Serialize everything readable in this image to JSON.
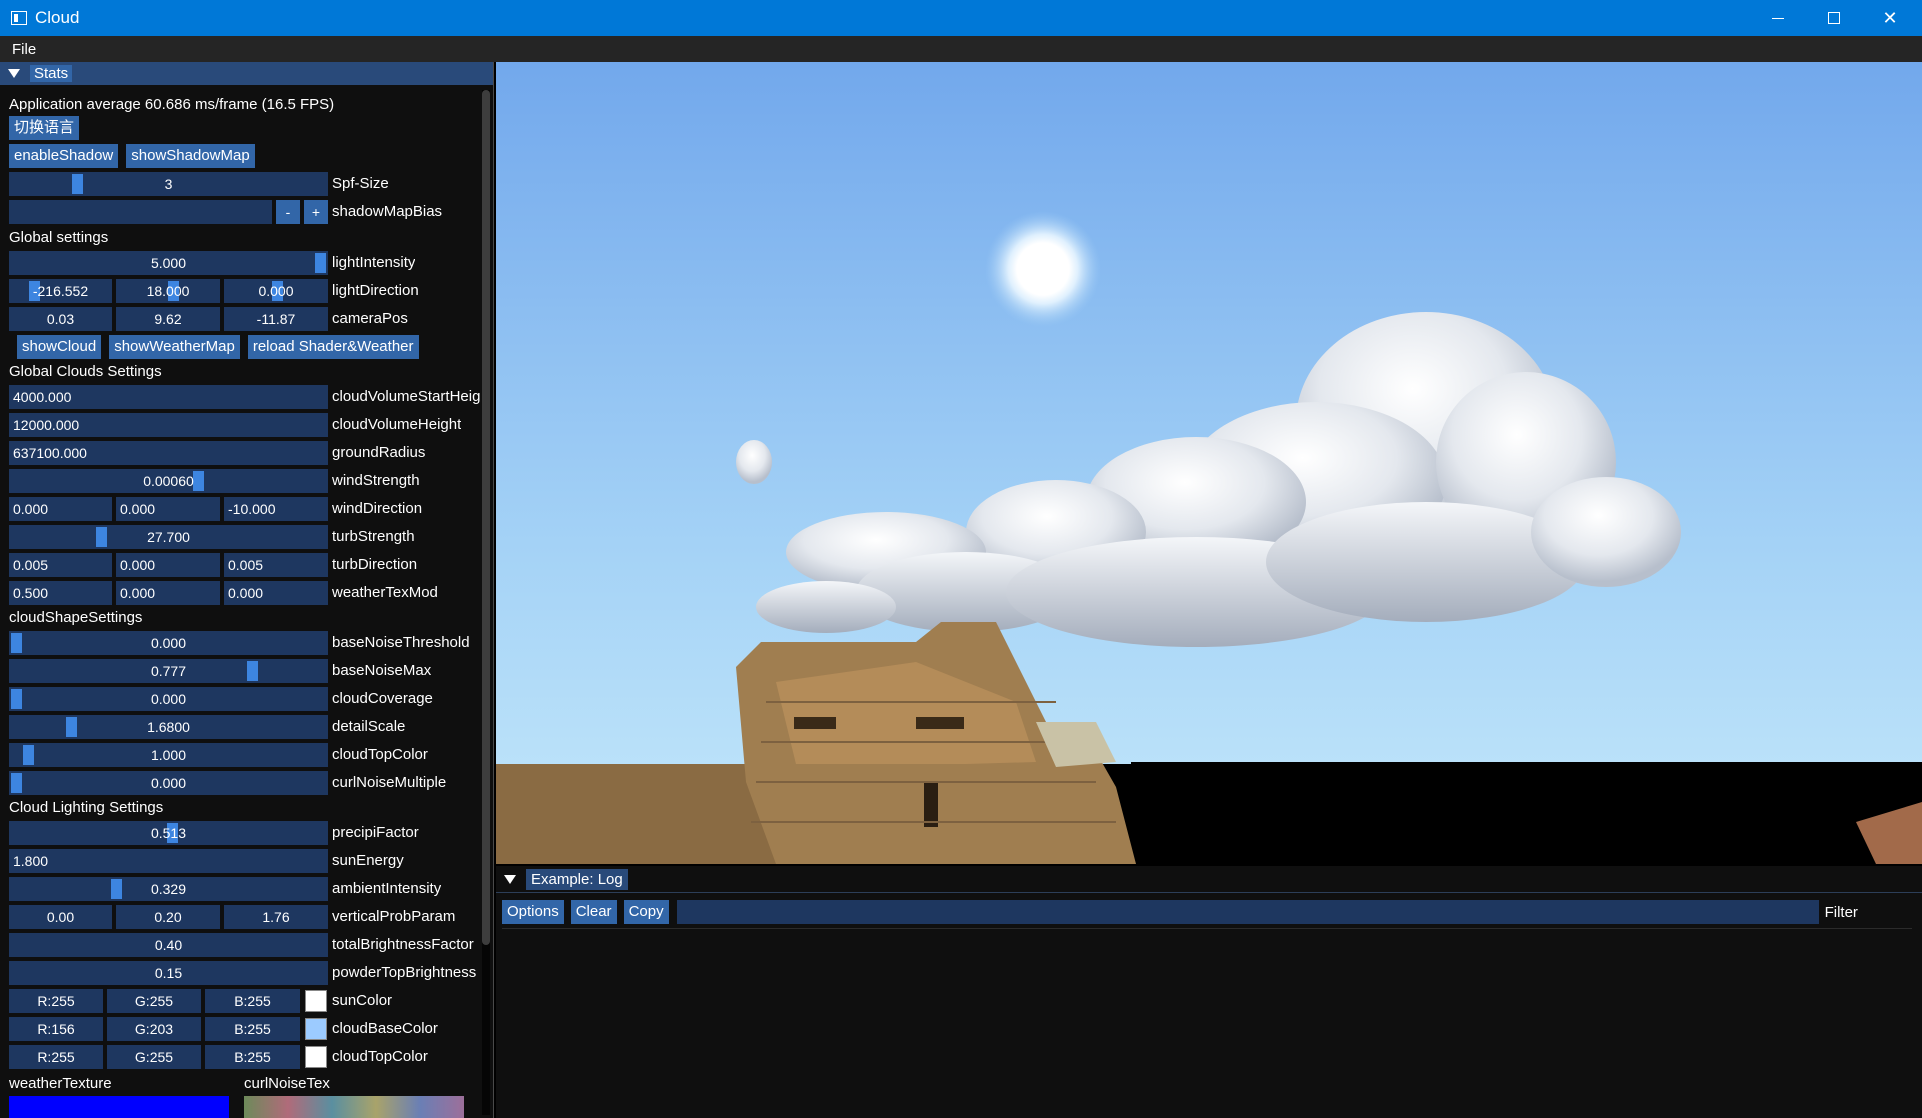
{
  "window": {
    "title": "Cloud",
    "min_icon": "minimize-icon",
    "max_icon": "maximize-icon",
    "close_icon": "close-icon"
  },
  "menu": {
    "file": "File"
  },
  "stats": {
    "header": "Stats",
    "fps_text": "Application average 60.686 ms/frame (16.5 FPS)",
    "language_button": "切换语言",
    "enable_shadow": "enableShadow",
    "show_shadow_map": "showShadowMap",
    "spf_size": {
      "value": "3",
      "label": "Spf-Size",
      "fraction": 0.2
    },
    "shadow_map_bias": {
      "value": "",
      "minus": "-",
      "plus": "+",
      "label": "shadowMapBias"
    },
    "global_settings": "Global settings",
    "light_intensity": {
      "value": "5.000",
      "label": "lightIntensity",
      "fraction": 1.0
    },
    "light_direction": {
      "values": [
        "-216.552",
        "18.000",
        "0.000"
      ],
      "label": "lightDirection"
    },
    "camera_pos": {
      "values": [
        "0.03",
        "9.62",
        "-11.87"
      ],
      "label": "cameraPos"
    },
    "show_cloud": "showCloud",
    "show_weather_map": "showWeatherMap",
    "reload_shader": "reload Shader&Weather",
    "global_clouds": "Global Clouds Settings",
    "cloud_volume_start": {
      "value": "4000.000",
      "label": "cloudVolumeStartHeig"
    },
    "cloud_volume_height": {
      "value": "12000.000",
      "label": "cloudVolumeHeight"
    },
    "ground_radius": {
      "value": "637100.000",
      "label": "groundRadius"
    },
    "wind_strength": {
      "value": "0.00060",
      "label": "windStrength",
      "fraction": 0.6
    },
    "wind_direction": {
      "values": [
        "0.000",
        "0.000",
        "-10.000"
      ],
      "label": "windDirection"
    },
    "turb_strength": {
      "value": "27.700",
      "label": "turbStrength",
      "fraction": 0.28
    },
    "turb_direction": {
      "values": [
        "0.005",
        "0.000",
        "0.005"
      ],
      "label": "turbDirection"
    },
    "weather_tex_mod": {
      "values": [
        "0.500",
        "0.000",
        "0.000"
      ],
      "label": "weatherTexMod"
    },
    "cloud_shape": "cloudShapeSettings",
    "base_noise_threshold": {
      "value": "0.000",
      "label": "baseNoiseThreshold",
      "fraction": 0.0
    },
    "base_noise_max": {
      "value": "0.777",
      "label": "baseNoiseMax",
      "fraction": 0.777
    },
    "cloud_coverage": {
      "value": "0.000",
      "label": "cloudCoverage",
      "fraction": 0.0
    },
    "detail_scale": {
      "value": "1.6800",
      "label": "detailScale",
      "fraction": 0.18
    },
    "cloud_top_color_scalar": {
      "value": "1.000",
      "label": "cloudTopColor",
      "fraction": 0.04
    },
    "curl_noise_multiple": {
      "value": "0.000",
      "label": "curlNoiseMultiple",
      "fraction": 0.0
    },
    "cloud_lighting": "Cloud Lighting Settings",
    "precipi_factor": {
      "value": "0.513",
      "label": "precipiFactor",
      "fraction": 0.513
    },
    "sun_energy": {
      "value": "1.800",
      "label": "sunEnergy"
    },
    "ambient_intensity": {
      "value": "0.329",
      "label": "ambientIntensity",
      "fraction": 0.329
    },
    "vertical_prob_param": {
      "values": [
        "0.00",
        "0.20",
        "1.76"
      ],
      "label": "verticalProbParam"
    },
    "total_brightness": {
      "value": "0.40",
      "label": "totalBrightnessFactor"
    },
    "powder_top": {
      "value": "0.15",
      "label": "powderTopBrightness"
    },
    "sun_color": {
      "values": [
        "R:255",
        "G:255",
        "B:255"
      ],
      "label": "sunColor",
      "color": "#ffffff"
    },
    "cloud_base_color": {
      "values": [
        "R:156",
        "G:203",
        "B:255"
      ],
      "label": "cloudBaseColor",
      "color": "#9ccbff"
    },
    "cloud_top_color": {
      "values": [
        "R:255",
        "G:255",
        "B:255"
      ],
      "label": "cloudTopColor",
      "color": "#ffffff"
    },
    "weather_texture": "weatherTexture",
    "curl_noise_tex": "curlNoiseTex"
  },
  "log": {
    "header": "Example: Log",
    "options": "Options",
    "clear": "Clear",
    "copy": "Copy",
    "filter_label": "Filter",
    "filter_value": ""
  },
  "colors": {
    "titlebar": "#0078d7",
    "frame": "#1e3760",
    "button": "#3266a8",
    "grab": "#3d85e0",
    "header": "#294a7a"
  }
}
